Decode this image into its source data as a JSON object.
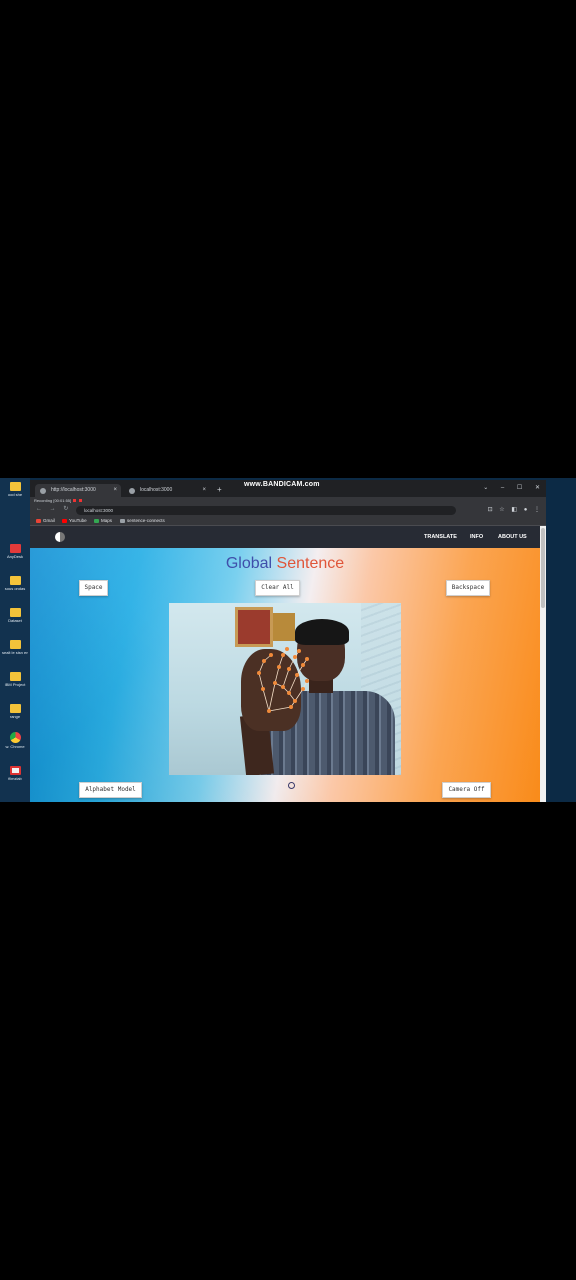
{
  "recording_watermark": "www.BANDICAM.com",
  "desktop_icons": [
    {
      "label": "ood she",
      "kind": "folder"
    },
    {
      "label": "AnyDesk",
      "kind": "app"
    },
    {
      "label": "sous ondas",
      "kind": "folder"
    },
    {
      "label": "Dataset",
      "kind": "folder"
    },
    {
      "label": "sealt le sisn encoth ...",
      "kind": "folder"
    },
    {
      "label": "IBM Project",
      "kind": "folder"
    },
    {
      "label": "range",
      "kind": "folder"
    },
    {
      "label": "w. Chrome",
      "kind": "chrome"
    },
    {
      "label": "filmzlab",
      "kind": "appw"
    }
  ],
  "browser": {
    "tabs": [
      {
        "title": "http://localhost:3000",
        "close": "×"
      },
      {
        "title": "localhost:3000",
        "close": "×"
      }
    ],
    "new_tab": "+",
    "window_controls": [
      "⌄",
      "–",
      "☐",
      "✕"
    ],
    "recording_label": "Recording [00:01:55]",
    "nav": [
      "←",
      "→",
      "↻"
    ],
    "address": "localhost:3000",
    "bookmarks": [
      {
        "label": "Gmail",
        "color": "#ea4335"
      },
      {
        "label": "YouTube",
        "color": "#ff0000"
      },
      {
        "label": "Maps",
        "color": "#34a853"
      },
      {
        "label": "sentence-connects",
        "color": "#9aa0a6"
      }
    ],
    "ext_icons": [
      "⊡",
      "☆",
      "◧",
      "●",
      "⋮"
    ]
  },
  "navbar": {
    "links": [
      "TRANSLATE",
      "INFO",
      "ABOUT US"
    ]
  },
  "page": {
    "title_part1": "Global ",
    "title_part2": "Sentence",
    "buttons": {
      "space": "Space",
      "clear_all": "Clear All",
      "backspace": "Backspace",
      "alphabet_model": "Alphabet Model",
      "camera_off": "Camera Off"
    }
  },
  "colors": {
    "title_blue": "#3f4faa",
    "title_orange": "#e0563a",
    "landmark": "#f08a3a"
  }
}
